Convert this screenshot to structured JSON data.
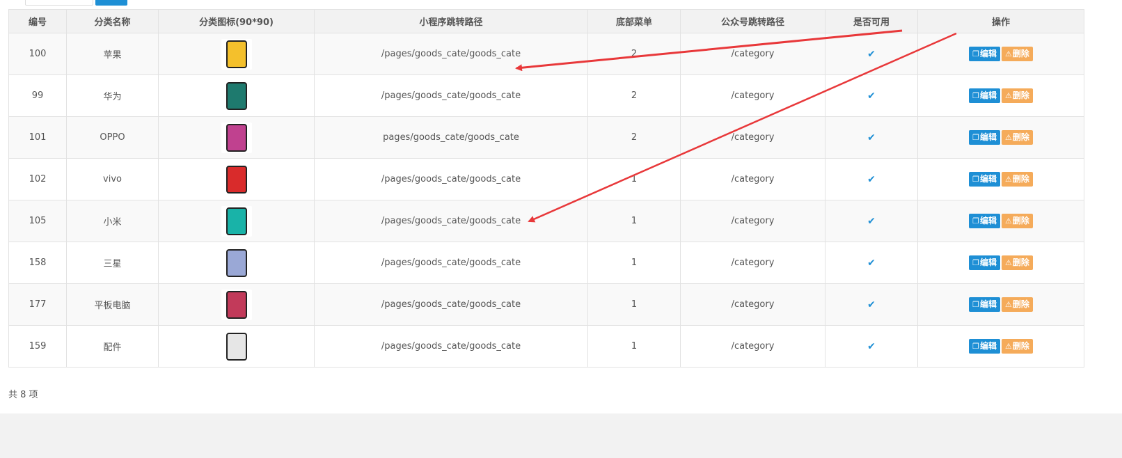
{
  "table": {
    "headers": [
      "编号",
      "分类名称",
      "分类图标(90*90)",
      "小程序跳转路径",
      "底部菜单",
      "公众号跳转路径",
      "是否可用",
      "操作"
    ],
    "rows": [
      {
        "id": "100",
        "name": "苹果",
        "icon": "phone-yellow-icon",
        "icon_color": "#f4c02c",
        "mini_path": "/pages/goods_cate/goods_cate",
        "bottom_menu": "2",
        "mp_path": "/category",
        "enabled": "✔"
      },
      {
        "id": "99",
        "name": "华为",
        "icon": "phone-green-icon",
        "icon_color": "#1e7a6e",
        "mini_path": "/pages/goods_cate/goods_cate",
        "bottom_menu": "2",
        "mp_path": "/category",
        "enabled": "✔"
      },
      {
        "id": "101",
        "name": "OPPO",
        "icon": "phone-gradient-icon",
        "icon_color": "#c0418f",
        "mini_path": "pages/goods_cate/goods_cate",
        "bottom_menu": "2",
        "mp_path": "/category",
        "enabled": "✔"
      },
      {
        "id": "102",
        "name": "vivo",
        "icon": "phone-red-icon",
        "icon_color": "#d92b2b",
        "mini_path": "/pages/goods_cate/goods_cate",
        "bottom_menu": "1",
        "mp_path": "/category",
        "enabled": "✔"
      },
      {
        "id": "105",
        "name": "小米",
        "icon": "phone-teal-icon",
        "icon_color": "#19b3a8",
        "mini_path": "/pages/goods_cate/goods_cate",
        "bottom_menu": "1",
        "mp_path": "/category",
        "enabled": "✔"
      },
      {
        "id": "158",
        "name": "三星",
        "icon": "phone-silver-icon",
        "icon_color": "#9aa8d6",
        "mini_path": "/pages/goods_cate/goods_cate",
        "bottom_menu": "1",
        "mp_path": "/category",
        "enabled": "✔"
      },
      {
        "id": "177",
        "name": "平板电脑",
        "icon": "tablet-icon",
        "icon_color": "#c23a5a",
        "mini_path": "/pages/goods_cate/goods_cate",
        "bottom_menu": "1",
        "mp_path": "/category",
        "enabled": "✔"
      },
      {
        "id": "159",
        "name": "配件",
        "icon": "charger-icon",
        "icon_color": "#e6e6e6",
        "mini_path": "/pages/goods_cate/goods_cate",
        "bottom_menu": "1",
        "mp_path": "/category",
        "enabled": "✔"
      }
    ],
    "actions": {
      "edit_label": "编辑",
      "delete_label": "删除",
      "edit_icon": "copy-icon",
      "delete_icon": "warning-icon"
    }
  },
  "total_label": "共 8 项",
  "colors": {
    "primary": "#1e8fd5",
    "warning": "#f5ab5a",
    "annotation": "#e8383a"
  }
}
